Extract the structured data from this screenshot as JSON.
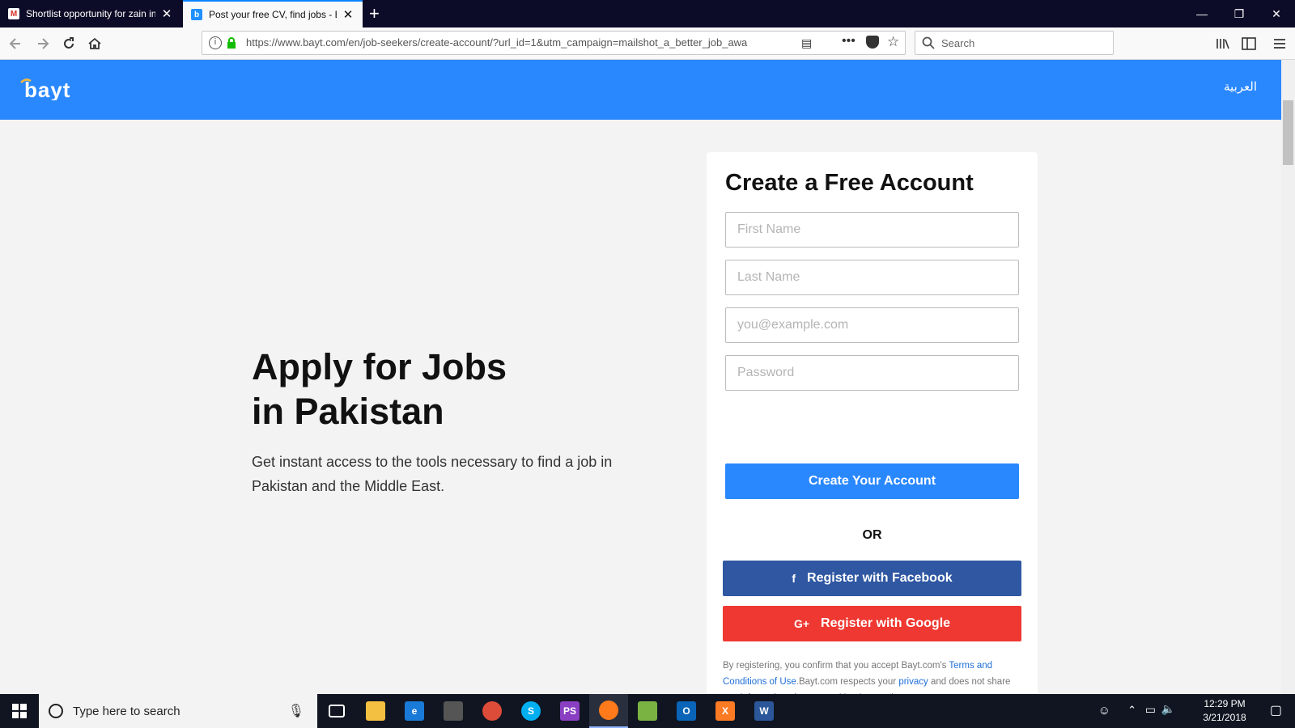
{
  "browser": {
    "tabs": [
      {
        "title": "Shortlist opportunity for zain in",
        "favicon": "gmail-icon"
      },
      {
        "title": "Post your free CV, find jobs - Ba",
        "favicon": "bayt-icon"
      }
    ],
    "url": "https://www.bayt.com/en/job-seekers/create-account/?url_id=1&utm_campaign=mailshot_a_better_job_awa",
    "search_placeholder": "Search"
  },
  "site": {
    "logo_text": "bayt",
    "language_link": "العربية",
    "brand_color": "#2a88ff"
  },
  "hero": {
    "title_line1": "Apply for Jobs",
    "title_line2": "in Pakistan",
    "description": "Get instant access to the tools necessary to find a job in Pakistan and the Middle East."
  },
  "signup": {
    "title": "Create a Free Account",
    "first_name_placeholder": "First Name",
    "last_name_placeholder": "Last Name",
    "email_placeholder": "you@example.com",
    "password_placeholder": "Password",
    "create_button": "Create Your Account",
    "or_label": "OR",
    "facebook_button": "Register with Facebook",
    "google_button": "Register with Google",
    "legal": {
      "part1": "By registering, you confirm that you accept Bayt.com's ",
      "terms_link": "Terms and Conditions of Use",
      "part2": ".Bayt.com respects your ",
      "privacy_link": "privacy",
      "part3": " and does not share any information about you with other parties."
    }
  },
  "taskbar": {
    "search_placeholder": "Type here to search",
    "time": "12:29 PM",
    "date": "3/21/2018"
  }
}
